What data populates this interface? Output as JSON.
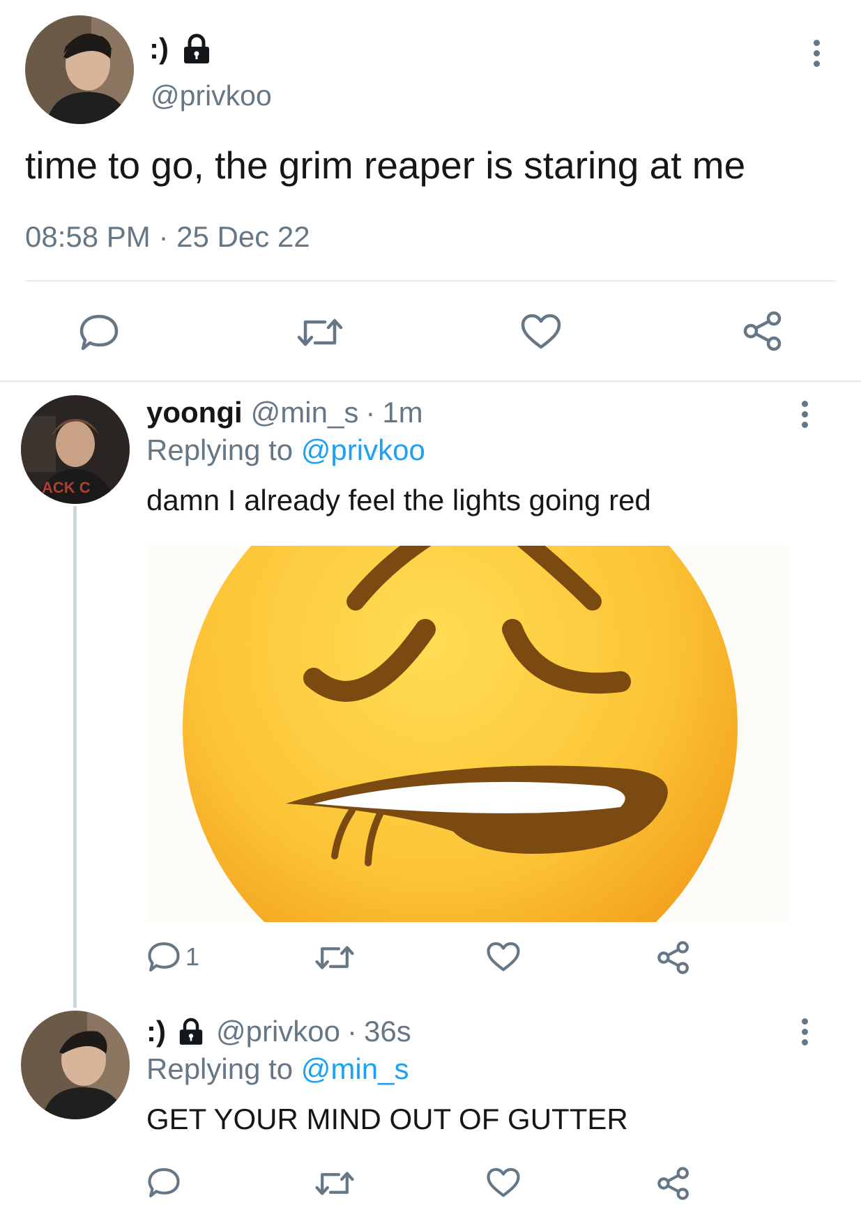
{
  "main_tweet": {
    "display_name": ":)",
    "handle": "@privkoo",
    "text": "time to go, the grim reaper is staring at me",
    "time": "08:58 PM",
    "separator": "·",
    "date": "25 Dec 22"
  },
  "reply1": {
    "display_name": "yoongi",
    "handle": "@min_s",
    "dot": "·",
    "age": "1m",
    "replying_prefix": "Replying to",
    "replying_handle": "@privkoo",
    "text": "damn I already feel the lights going red",
    "reply_count": "1"
  },
  "reply2": {
    "display_name": ":)",
    "handle": "@privkoo",
    "dot": "·",
    "age": "36s",
    "replying_prefix": "Replying to",
    "replying_handle": "@min_s",
    "text": "GET YOUR MIND OUT OF GUTTER"
  },
  "colors": {
    "accent": "#1da1f2",
    "muted": "#657786",
    "divider": "#e6ecf0"
  },
  "icons": [
    "lock-icon",
    "more-vertical-icon",
    "reply-icon",
    "retweet-icon",
    "like-icon",
    "share-icon"
  ]
}
